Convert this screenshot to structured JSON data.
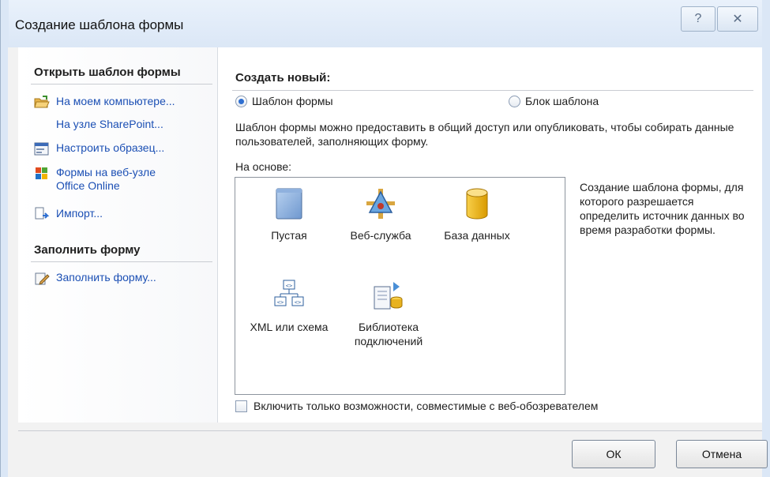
{
  "window": {
    "title": "Создание шаблона формы",
    "help_glyph": "?",
    "close_glyph": "✕"
  },
  "left": {
    "open_header": "Открыть шаблон формы",
    "items": [
      {
        "label": "На моем компьютере...",
        "icon": "open-folder-icon"
      },
      {
        "label": "На узле SharePoint...",
        "icon": ""
      },
      {
        "label": "Настроить образец...",
        "icon": "customize-sample-icon"
      },
      {
        "label": "Формы на веб-узле Office Online",
        "icon": "office-online-icon"
      },
      {
        "label": "Импорт...",
        "icon": "import-icon"
      }
    ],
    "fill_header": "Заполнить форму",
    "fill_item": {
      "label": "Заполнить форму...",
      "icon": "fill-form-icon"
    }
  },
  "right": {
    "create_header": "Создать новый:",
    "radio_form": "Шаблон формы",
    "radio_block": "Блок шаблона",
    "description": "Шаблон формы можно предоставить в общий доступ или опубликовать, чтобы собирать данные пользователей, заполняющих форму.",
    "basis_label": "На основе:",
    "tiles": [
      {
        "label": "Пустая",
        "icon": "blank-form-icon"
      },
      {
        "label": "Веб-служба",
        "icon": "web-service-icon"
      },
      {
        "label": "База данных",
        "icon": "database-icon"
      },
      {
        "label": "XML или схема",
        "icon": "xml-schema-icon"
      },
      {
        "label": "Библиотека подключений",
        "icon": "connection-library-icon"
      }
    ],
    "side_description": "Создание шаблона формы, для которого разрешается определить источник данных во время разработки формы.",
    "checkbox_label": "Включить только возможности, совместимые с веб-обозревателем"
  },
  "buttons": {
    "ok": "ОК",
    "cancel": "Отмена"
  },
  "colors": {
    "link": "#1b4fb4",
    "radio_selected": "#2f6fd1",
    "database": "#f2b300"
  }
}
